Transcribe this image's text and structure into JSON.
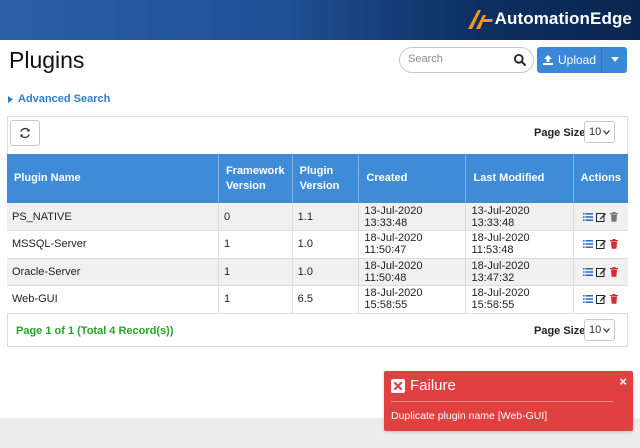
{
  "brand": {
    "name": "AutomationEdge"
  },
  "page": {
    "title": "Plugins"
  },
  "search": {
    "placeholder": "Search"
  },
  "upload": {
    "label": "Upload"
  },
  "advanced_search": {
    "label": "Advanced Search"
  },
  "page_size": {
    "label": "Page Size",
    "value": "10"
  },
  "table": {
    "headers": {
      "plugin_name": "Plugin Name",
      "framework_version": "Framework Version",
      "plugin_version": "Plugin Version",
      "created": "Created",
      "last_modified": "Last Modified",
      "actions": "Actions"
    },
    "rows": [
      {
        "name": "PS_NATIVE",
        "framework": "0",
        "plugin": "1.1",
        "created": "13-Jul-2020 13:33:48",
        "modified": "13-Jul-2020 13:33:48"
      },
      {
        "name": "MSSQL-Server",
        "framework": "1",
        "plugin": "1.0",
        "created": "18-Jul-2020 11:50:47",
        "modified": "18-Jul-2020 11:53:48"
      },
      {
        "name": "Oracle-Server",
        "framework": "1",
        "plugin": "1.0",
        "created": "18-Jul-2020 11:50:48",
        "modified": "18-Jul-2020 13:47:32"
      },
      {
        "name": "Web-GUI",
        "framework": "1",
        "plugin": "6.5",
        "created": "18-Jul-2020 15:58:55",
        "modified": "18-Jul-2020 15:58:55"
      }
    ]
  },
  "pagination": {
    "summary": "Page 1 of 1 (Total 4 Record(s))"
  },
  "toast": {
    "title": "Failure",
    "close": "×",
    "message": "Duplicate plugin name [Web-GUI]"
  },
  "colors": {
    "header_blue": "#3f8bd8",
    "accent": "#f7931e",
    "failure": "#e04040",
    "success": "#29a329"
  }
}
